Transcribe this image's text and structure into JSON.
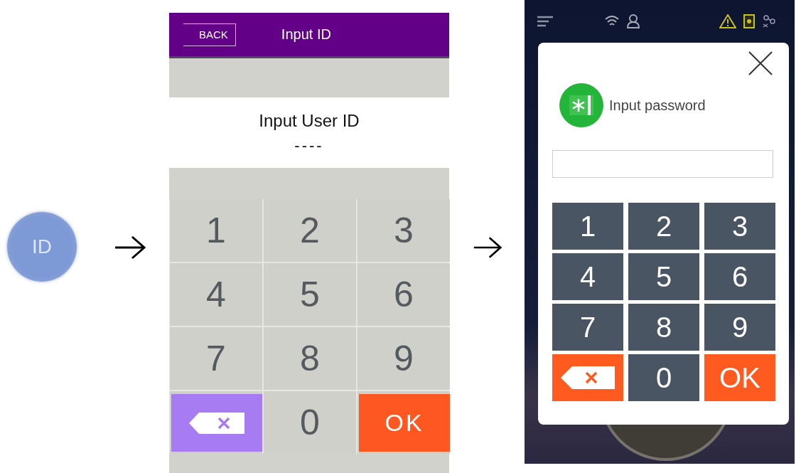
{
  "start_button": {
    "label": "ID"
  },
  "id_screen": {
    "back_button": "BACK",
    "title": "Input ID",
    "prompt": "Input User ID",
    "value": "----",
    "keys": [
      {
        "kind": "digit",
        "label": "1"
      },
      {
        "kind": "digit",
        "label": "2"
      },
      {
        "kind": "digit",
        "label": "3"
      },
      {
        "kind": "digit",
        "label": "4"
      },
      {
        "kind": "digit",
        "label": "5"
      },
      {
        "kind": "digit",
        "label": "6"
      },
      {
        "kind": "digit",
        "label": "7"
      },
      {
        "kind": "digit",
        "label": "8"
      },
      {
        "kind": "digit",
        "label": "9"
      },
      {
        "kind": "backspace"
      },
      {
        "kind": "digit",
        "label": "0"
      },
      {
        "kind": "ok",
        "label": "OK"
      }
    ]
  },
  "password_screen": {
    "prompt": "Input password",
    "keys": [
      {
        "kind": "digit",
        "label": "1"
      },
      {
        "kind": "digit",
        "label": "2"
      },
      {
        "kind": "digit",
        "label": "3"
      },
      {
        "kind": "digit",
        "label": "4"
      },
      {
        "kind": "digit",
        "label": "5"
      },
      {
        "kind": "digit",
        "label": "6"
      },
      {
        "kind": "digit",
        "label": "7"
      },
      {
        "kind": "digit",
        "label": "8"
      },
      {
        "kind": "digit",
        "label": "9"
      },
      {
        "kind": "backspace"
      },
      {
        "kind": "digit",
        "label": "0"
      },
      {
        "kind": "ok",
        "label": "OK"
      }
    ]
  }
}
